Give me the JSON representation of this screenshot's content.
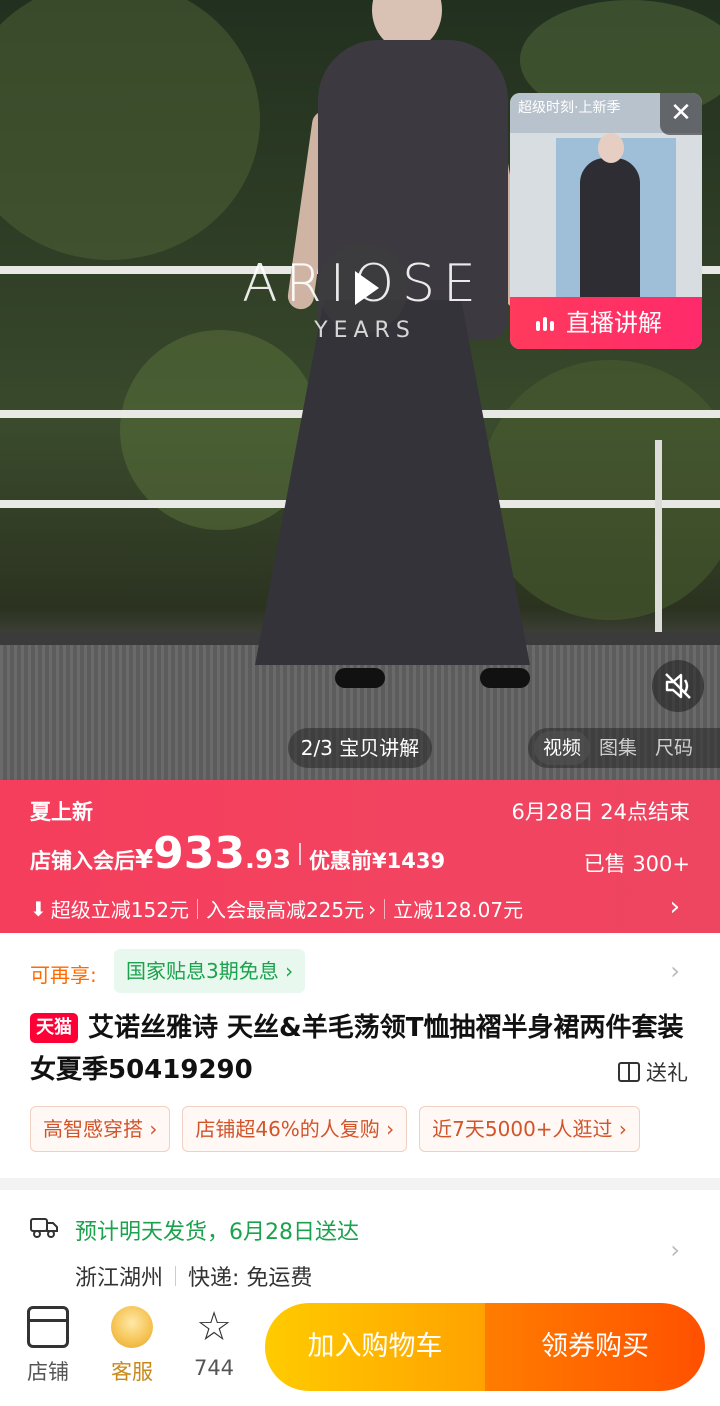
{
  "media": {
    "brand_logo": "ARIOSE",
    "brand_sub": "YEARS",
    "live": {
      "header": "超级时刻·上新季",
      "button": "直播讲解",
      "close_icon": "close-icon"
    },
    "counter": "2/3 宝贝讲解",
    "tabs": [
      "视频",
      "图集",
      "尺码"
    ],
    "active_tab": 0
  },
  "promo": {
    "title": "夏上新",
    "end": "6月28日 24点结束",
    "price_label": "店铺入会后",
    "currency": "¥",
    "price_int": "933",
    "price_dec": ".93",
    "orig_price": "优惠前¥1439",
    "sold": "已售 300+",
    "deals": [
      "超级立减152元",
      "入会最高减225元",
      "立减128.07元"
    ]
  },
  "info": {
    "extra_label": "可再享:",
    "extra_chip": "国家贴息3期免息",
    "tag": "天猫",
    "title": "艾诺丝雅诗 天丝&羊毛荡领T恤抽褶半身裙两件套装女夏季50419290",
    "gift": "送礼",
    "chips": [
      "高智感穿搭",
      "店铺超46%的人复购",
      "近7天5000+人逛过"
    ]
  },
  "shipping": {
    "estimate": "预计明天发货，6月28日送达",
    "origin": "浙江湖州",
    "express": "快递: 免运费"
  },
  "bar": {
    "store": "店铺",
    "service": "客服",
    "favorites": "744",
    "cart": "加入购物车",
    "buy": "领券购买"
  },
  "colors": {
    "promo_red": "#f53d5c",
    "cart_yellow": "#ffb300",
    "buy_orange": "#ff5a00",
    "green": "#1aa24c"
  }
}
